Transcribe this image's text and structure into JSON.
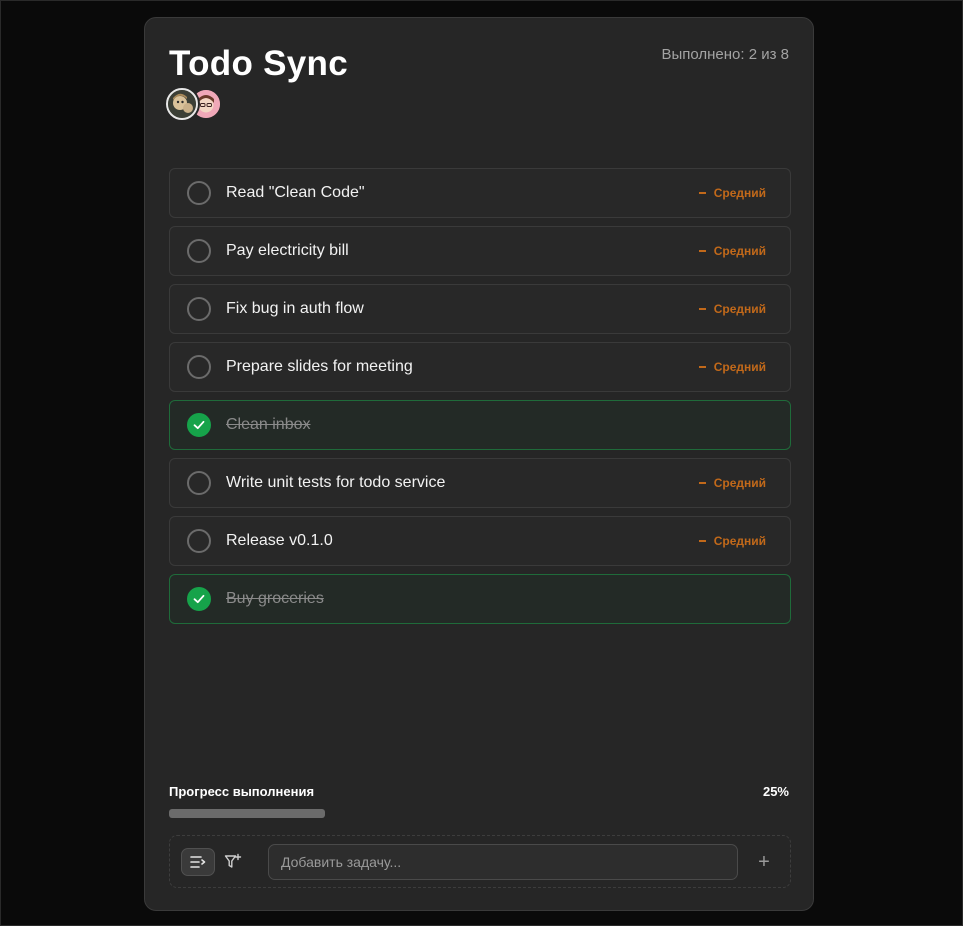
{
  "header": {
    "title": "Todo Sync",
    "done_counter": "Выполнено: 2 из 8"
  },
  "avatars": [
    {
      "name": "avatar-user-1",
      "color": "#3b3f36"
    },
    {
      "name": "avatar-user-2",
      "color": "#f0a8b8"
    }
  ],
  "tasks": [
    {
      "title": "Read \"Clean Code\"",
      "done": false,
      "priority": "Средний"
    },
    {
      "title": "Pay electricity bill",
      "done": false,
      "priority": "Средний"
    },
    {
      "title": "Fix bug in auth flow",
      "done": false,
      "priority": "Средний"
    },
    {
      "title": "Prepare slides for meeting",
      "done": false,
      "priority": "Средний"
    },
    {
      "title": "Clean inbox",
      "done": true,
      "priority": ""
    },
    {
      "title": "Write unit tests for todo service",
      "done": false,
      "priority": "Средний"
    },
    {
      "title": "Release v0.1.0",
      "done": false,
      "priority": "Средний"
    },
    {
      "title": "Buy groceries",
      "done": true,
      "priority": ""
    }
  ],
  "progress": {
    "label": "Прогресс выполнения",
    "value_text": "25%",
    "fraction": 0.25
  },
  "composer": {
    "placeholder": "Добавить задачу...",
    "add_symbol": "+",
    "sort_icon": "sort-list-icon",
    "filter_icon": "filter-plus-icon"
  },
  "colors": {
    "background": "#0a0a0a",
    "card": "#262626",
    "done_check": "#16a34a",
    "priority_medium": "#c2691a"
  }
}
